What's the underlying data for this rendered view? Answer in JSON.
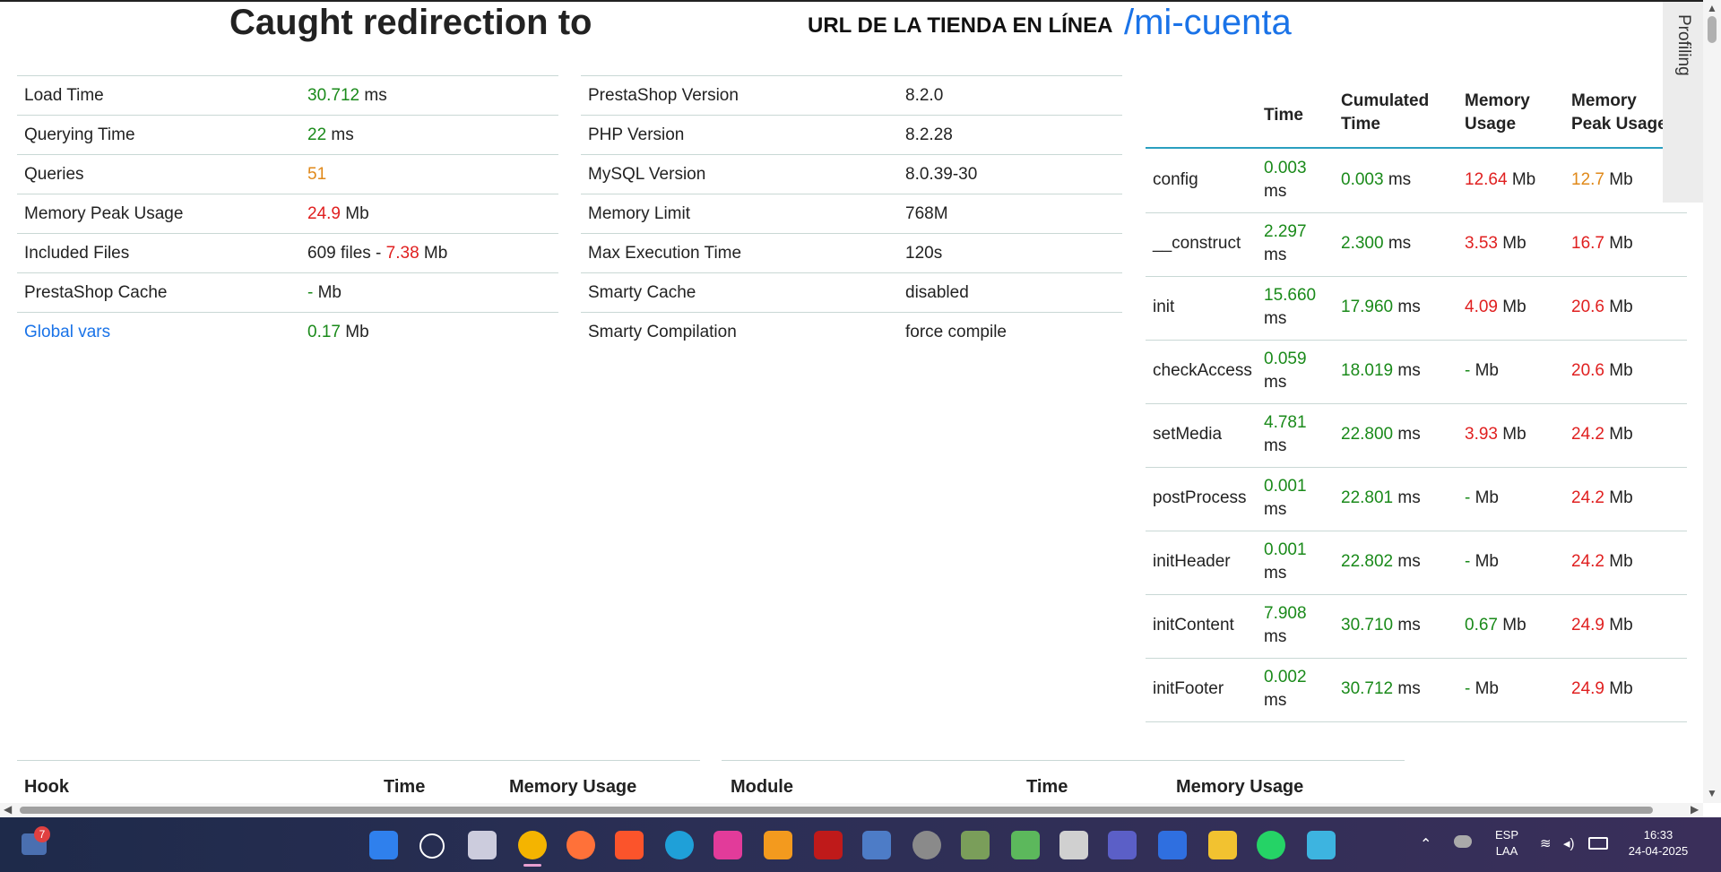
{
  "header": {
    "caught": "Caught redirection to",
    "url_label": "URL DE LA TIENDA EN LÍNEA",
    "path": "/mi-cuenta"
  },
  "stats": [
    {
      "label": "Load Time",
      "value": "30.712",
      "unit": " ms",
      "value_color": "green"
    },
    {
      "label": "Querying Time",
      "value": "22",
      "unit": " ms",
      "value_color": "green"
    },
    {
      "label": "Queries",
      "value": "51",
      "unit": "",
      "value_color": "orange"
    },
    {
      "label": "Memory Peak Usage",
      "value": "24.9",
      "unit": " Mb",
      "value_color": "red"
    },
    {
      "label": "Included Files",
      "value": "609 files - ",
      "value2": "7.38",
      "unit": " Mb",
      "value_color": "plain"
    },
    {
      "label": "PrestaShop Cache",
      "value": "-",
      "unit": " Mb",
      "value_color": "green"
    },
    {
      "label": "Global vars",
      "value": "0.17",
      "unit": " Mb",
      "value_color": "green"
    }
  ],
  "config": [
    {
      "label": "PrestaShop Version",
      "value": "8.2.0"
    },
    {
      "label": "PHP Version",
      "value": "8.2.28"
    },
    {
      "label": "MySQL Version",
      "value": "8.0.39-30"
    },
    {
      "label": "Memory Limit",
      "value": "768M"
    },
    {
      "label": "Max Execution Time",
      "value": "120s"
    },
    {
      "label": "Smarty Cache",
      "value": "disabled"
    },
    {
      "label": "Smarty Compilation",
      "value": "force compile"
    }
  ],
  "profiling": {
    "tab_label": "Profiling",
    "headers": {
      "time": "Time",
      "cumulated1": "Cumulated",
      "cumulated2": "Time",
      "mem1": "Memory",
      "mem2": "Usage",
      "peak1": "Memory",
      "peak2": "Peak Usage"
    },
    "rows": [
      {
        "name": "config",
        "time": "0.003",
        "cum": "0.003",
        "mem": "12.64",
        "mem_color": "red",
        "peak": "12.7",
        "peak_color": "orange"
      },
      {
        "name": "__construct",
        "time": "2.297",
        "cum": "2.300",
        "mem": "3.53",
        "mem_color": "red",
        "peak": "16.7",
        "peak_color": "red"
      },
      {
        "name": "init",
        "time": "15.660",
        "cum": "17.960",
        "mem": "4.09",
        "mem_color": "red",
        "peak": "20.6",
        "peak_color": "red"
      },
      {
        "name": "checkAccess",
        "time": "0.059",
        "cum": "18.019",
        "mem": "-",
        "mem_color": "green",
        "peak": "20.6",
        "peak_color": "red"
      },
      {
        "name": "setMedia",
        "time": "4.781",
        "cum": "22.800",
        "mem": "3.93",
        "mem_color": "red",
        "peak": "24.2",
        "peak_color": "red"
      },
      {
        "name": "postProcess",
        "time": "0.001",
        "cum": "22.801",
        "mem": "-",
        "mem_color": "green",
        "peak": "24.2",
        "peak_color": "red"
      },
      {
        "name": "initHeader",
        "time": "0.001",
        "cum": "22.802",
        "mem": "-",
        "mem_color": "green",
        "peak": "24.2",
        "peak_color": "red"
      },
      {
        "name": "initContent",
        "time": "7.908",
        "cum": "30.710",
        "mem": "0.67",
        "mem_color": "green",
        "peak": "24.9",
        "peak_color": "red"
      },
      {
        "name": "initFooter",
        "time": "0.002",
        "cum": "30.712",
        "mem": "-",
        "mem_color": "green",
        "peak": "24.9",
        "peak_color": "red"
      }
    ],
    "unit_ms": "ms",
    "unit_mb": "Mb"
  },
  "bottom": {
    "hook": "Hook",
    "time1": "Time",
    "mem1": "Memory Usage",
    "module": "Module",
    "time2": "Time",
    "mem2": "Memory Usage"
  },
  "taskbar": {
    "badge": "7",
    "lang1": "ESP",
    "lang2": "LAA",
    "time": "16:33",
    "date": "24-04-2025"
  }
}
